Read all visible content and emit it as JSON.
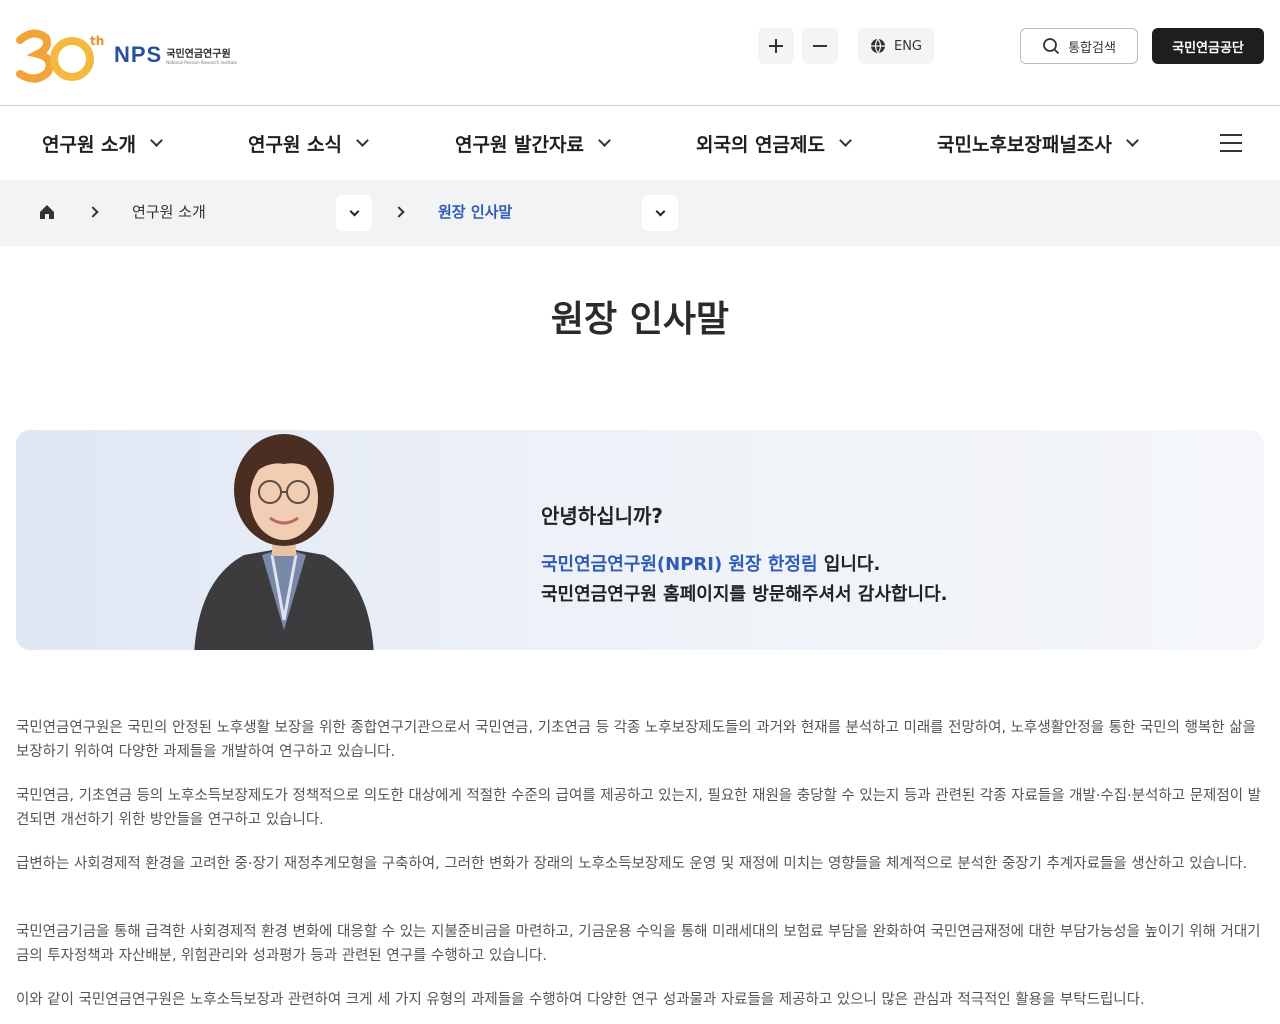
{
  "header": {
    "logo": {
      "num": "30",
      "sup": "th",
      "brand": "NPS",
      "name_ko": "국민연금연구원",
      "name_en": "National Pension Research Institute"
    },
    "zoom_in": "+",
    "zoom_out": "−",
    "lang_label": "ENG",
    "search_label": "통합검색",
    "nps_label": "국민연금공단"
  },
  "nav": {
    "items": [
      {
        "label": "연구원 소개"
      },
      {
        "label": "연구원 소식"
      },
      {
        "label": "연구원 발간자료"
      },
      {
        "label": "외국의 연금제도"
      },
      {
        "label": "국민노후보장패널조사"
      }
    ]
  },
  "breadcrumb": {
    "level1": "연구원 소개",
    "level2": "원장 인사말"
  },
  "page": {
    "title": "원장 인사말"
  },
  "greeting": {
    "hello": "안녕하십니까?",
    "intro_highlight": "국민연금연구원(NPRI) 원장 한정림",
    "intro_suffix": " 입니다.",
    "thanks": "국민연금연구원 홈페이지를 방문해주셔서 감사합니다."
  },
  "body": {
    "paragraphs": [
      "국민연금연구원은 국민의 안정된 노후생활 보장을 위한 종합연구기관으로서 국민연금, 기초연금 등 각종 노후보장제도들의 과거와 현재를 분석하고 미래를 전망하여, 노후생활안정을 통한 국민의 행복한 삶을 보장하기 위하여 다양한 과제들을 개발하여 연구하고 있습니다.",
      "국민연금, 기초연금 등의 노후소득보장제도가 정책적으로 의도한 대상에게 적절한 수준의 급여를 제공하고 있는지, 필요한 재원을 충당할 수 있는지 등과 관련된 각종 자료들을 개발·수집·분석하고 문제점이 발견되면 개선하기 위한 방안들을 연구하고 있습니다.",
      "급변하는 사회경제적 환경을 고려한 중·장기 재정추계모형을 구축하여, 그러한 변화가 장래의 노후소득보장제도 운영 및 재정에 미치는 영향들을 체계적으로 분석한 중장기 추계자료들을 생산하고 있습니다.",
      "국민연금기금을 통해 급격한 사회경제적 환경 변화에 대응할 수 있는 지불준비금을 마련하고, 기금운용 수익을 통해 미래세대의 보험료 부담을 완화하여 국민연금재정에 대한 부담가능성을 높이기 위해 거대기금의 투자정책과 자산배분, 위험관리와 성과평가 등과 관련된 연구를 수행하고 있습니다.",
      "이와 같이 국민연금연구원은 노후소득보장과 관련하여 크게 세 가지 유형의 과제들을 수행하여 다양한 연구 성과물과 자료들을 제공하고 있으니 많은 관심과 적극적인 활용을 부탁드립니다."
    ]
  }
}
